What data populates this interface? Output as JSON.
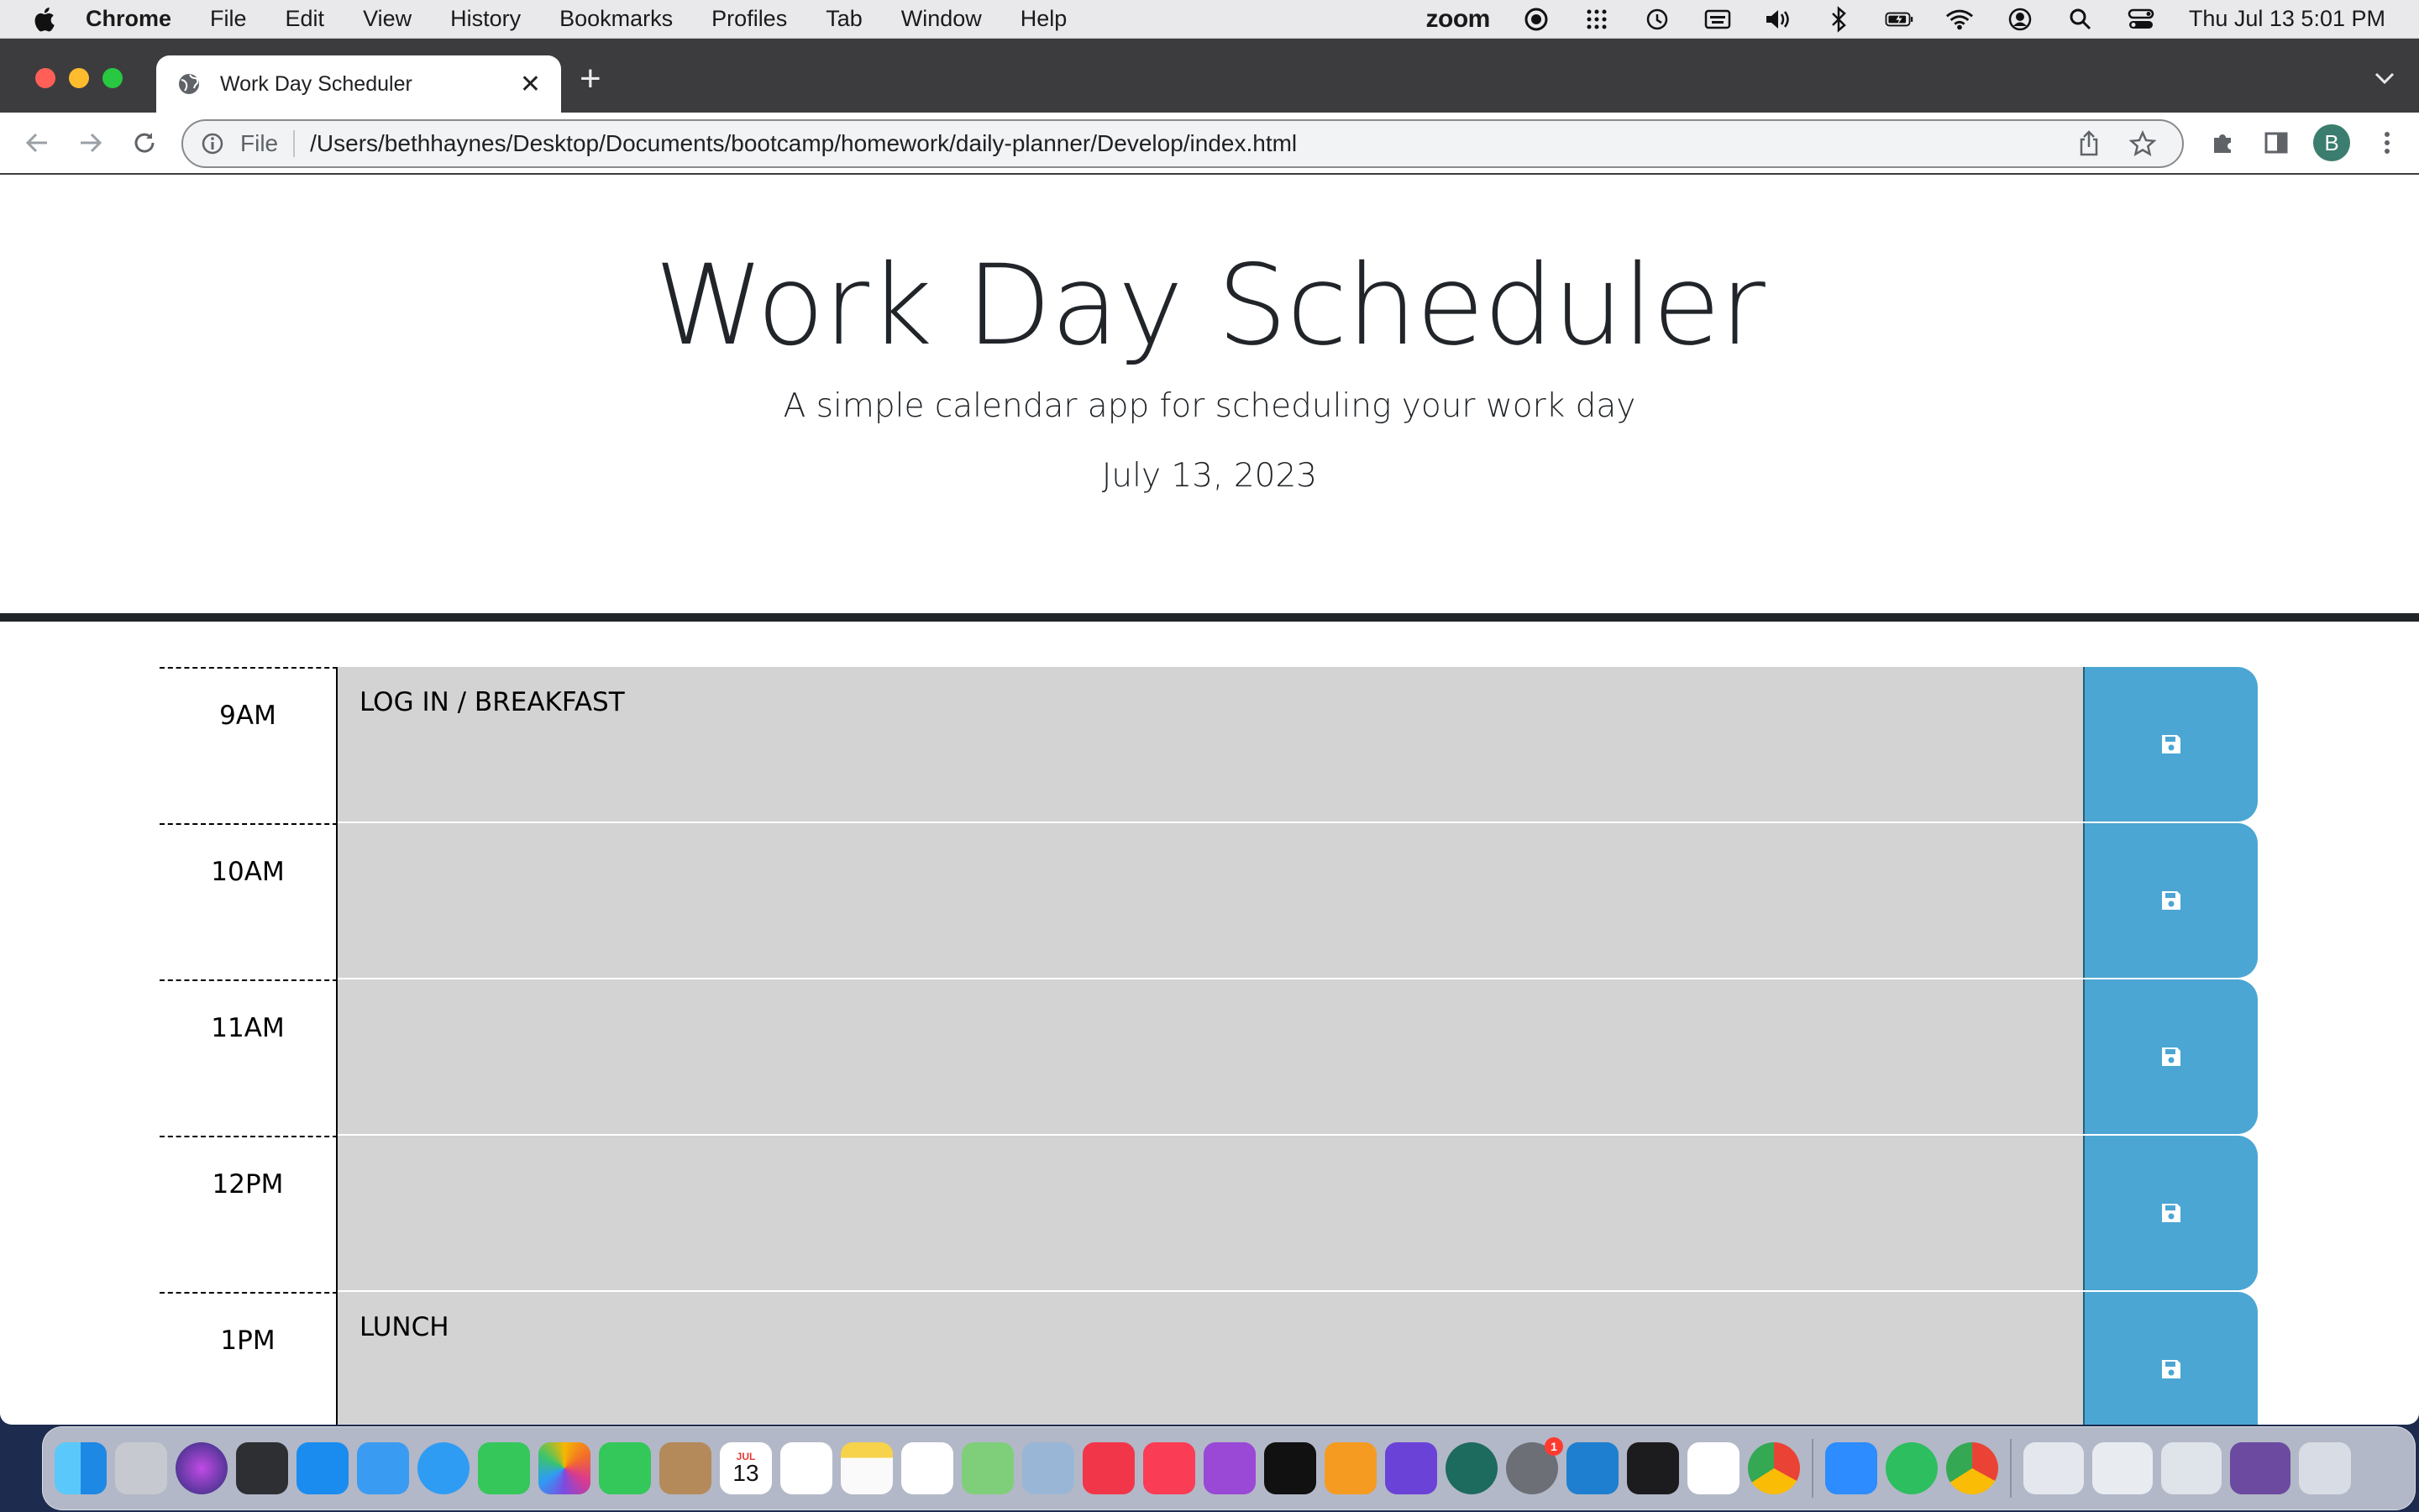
{
  "menubar": {
    "app_name": "Chrome",
    "menus": [
      "File",
      "Edit",
      "View",
      "History",
      "Bookmarks",
      "Profiles",
      "Tab",
      "Window",
      "Help"
    ],
    "zoom_label": "zoom",
    "datetime": "Thu Jul 13  5:01 PM"
  },
  "browser": {
    "tab_title": "Work Day Scheduler",
    "close_glyph": "✕",
    "newtab_glyph": "+",
    "address_prefix": "File",
    "address_url": "/Users/bethhaynes/Desktop/Documents/bootcamp/homework/daily-planner/Develop/index.html",
    "profile_initial": "B"
  },
  "page": {
    "title": "Work Day Scheduler",
    "subtitle": "A simple calendar app for scheduling your work day",
    "current_date": "July 13, 2023",
    "rows": [
      {
        "hour": "9AM",
        "text": "LOG IN / BREAKFAST"
      },
      {
        "hour": "10AM",
        "text": ""
      },
      {
        "hour": "11AM",
        "text": ""
      },
      {
        "hour": "12PM",
        "text": ""
      },
      {
        "hour": "1PM",
        "text": "LUNCH"
      }
    ]
  },
  "dock": {
    "calendar_month": "JUL",
    "calendar_day": "13",
    "system_prefs_badge": "1",
    "apps": [
      "finder",
      "launchpad",
      "siri",
      "mission-control",
      "app-store",
      "mail",
      "safari",
      "messages",
      "photos",
      "facetime",
      "contacts",
      "calendar",
      "reminders",
      "notes",
      "freeform",
      "maps",
      "preview",
      "news",
      "music",
      "podcasts",
      "tv",
      "books",
      "imovie",
      "time-machine",
      "system-preferences",
      "vscode",
      "terminal",
      "slack",
      "chrome",
      "zoom",
      "evernote",
      "chrome-2"
    ]
  },
  "colors": {
    "past_row": "#d3d3d3",
    "save_button": "#4ba6d3",
    "header_border": "#212529"
  }
}
